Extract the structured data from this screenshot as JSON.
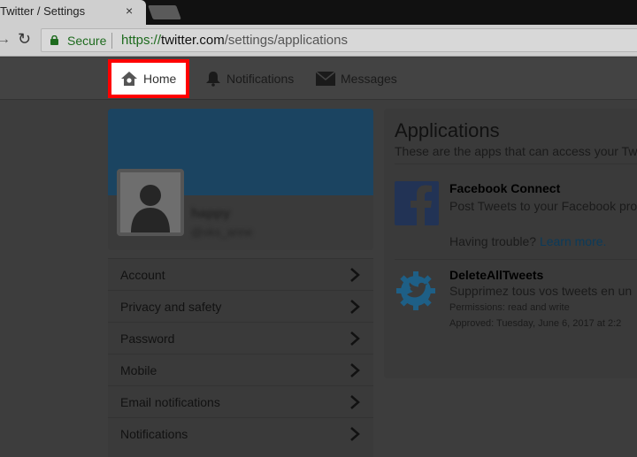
{
  "browser": {
    "tab_title": "Twitter / Settings",
    "tab_close": "×",
    "secure_label": "Secure",
    "url_scheme": "https://",
    "url_host": "twitter.com",
    "url_path": "/settings/applications"
  },
  "nav": {
    "home": "Home",
    "notifications": "Notifications",
    "messages": "Messages"
  },
  "profile": {
    "name": "happy",
    "handle": "@oks_anne"
  },
  "settings_menu": {
    "items": [
      {
        "label": "Account"
      },
      {
        "label": "Privacy and safety"
      },
      {
        "label": "Password"
      },
      {
        "label": "Mobile"
      },
      {
        "label": "Email notifications"
      },
      {
        "label": "Notifications"
      }
    ]
  },
  "applications": {
    "title": "Applications",
    "subtitle": "These are the apps that can access your Tw",
    "facebook": {
      "name": "Facebook Connect",
      "desc": "Post Tweets to your Facebook pro",
      "trouble": "Having trouble?",
      "learn_more": "Learn more."
    },
    "deletealltweets": {
      "name": "DeleteAllTweets",
      "desc": "Supprimez tous vos tweets en un",
      "permissions": "Permissions: read and write",
      "approved": "Approved: Tuesday, June 6, 2017 at 2:2"
    }
  },
  "colors": {
    "highlight": "#ff0000",
    "banner": "#1b4461",
    "facebook": "#223355",
    "twitter_bird": "#1e5f86"
  }
}
